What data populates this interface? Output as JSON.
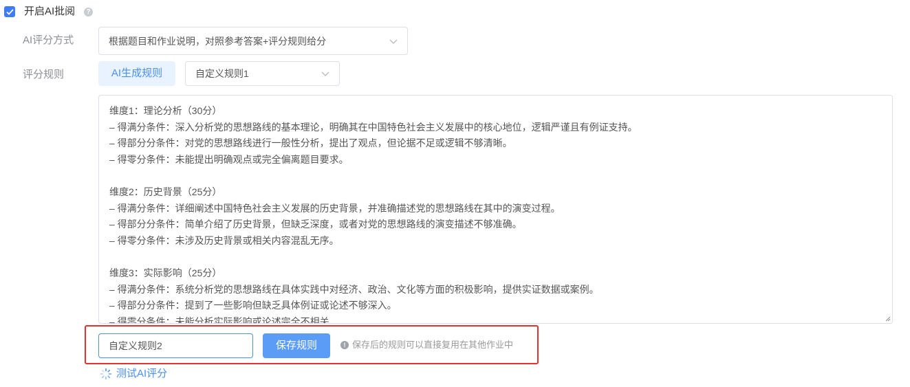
{
  "enable_ai": {
    "checked": true,
    "label": "开启AI批阅",
    "help_icon": "question-circle-icon",
    "help_glyph": "?"
  },
  "scoring_method": {
    "label": "AI评分方式",
    "selected": "根据题目和作业说明，对照参考答案+评分规则给分",
    "icon": "chevron-down-icon"
  },
  "scoring_rules": {
    "label": "评分规则",
    "ai_generate_button": "AI生成规则",
    "rule_select": {
      "selected": "自定义规则1",
      "icon": "chevron-down-icon"
    },
    "rules_text": [
      "维度1：理论分析（30分）",
      "– 得满分条件：深入分析党的思想路线的基本理论，明确其在中国特色社会主义发展中的核心地位，逻辑严谨且有例证支持。",
      "– 得部分分条件：对党的思想路线进行一般性分析，提出了观点，但论据不足或逻辑不够清晰。",
      "– 得零分条件：未能提出明确观点或完全偏离题目要求。",
      "",
      "维度2：历史背景（25分）",
      "– 得满分条件：详细阐述中国特色社会主义发展的历史背景，并准确描述党的思想路线在其中的演变过程。",
      "– 得部分分条件：简单介绍了历史背景，但缺乏深度，或者对党的思想路线的演变描述不够准确。",
      "– 得零分条件：未涉及历史背景或相关内容混乱无序。",
      "",
      "维度3：实际影响（25分）",
      "– 得满分条件：系统分析党的思想路线在具体实践中对经济、政治、文化等方面的积极影响，提供实证数据或案例。",
      "– 得部分分条件：提到了一些影响但缺乏具体例证或论述不够深入。",
      "– 得零分条件：未能分析实际影响或论述完全不相关"
    ]
  },
  "save_rule": {
    "name_value": "自定义规则2",
    "save_button": "保存规则",
    "hint_icon": "info-circle-icon",
    "hint_glyph": "!",
    "hint": "保存后的规则可以直接复用在其他作业中"
  },
  "test_ai_link": {
    "label": "测试AI评分",
    "icon": "loading-spinner-icon"
  },
  "colors": {
    "primary": "#4a8ef0",
    "highlight_border": "#e3312d",
    "checkbox": "#3f7cf4"
  }
}
